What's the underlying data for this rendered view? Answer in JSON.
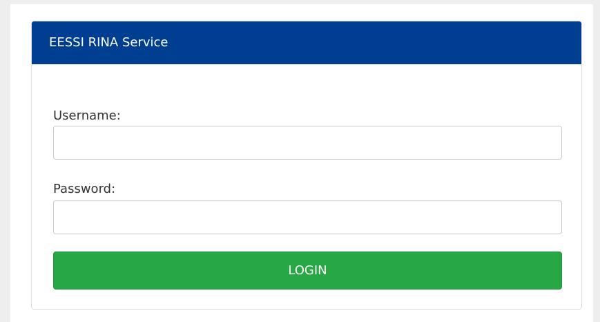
{
  "panel": {
    "title": "EESSI RINA Service"
  },
  "form": {
    "username_label": "Username:",
    "username_value": "",
    "password_label": "Password:",
    "password_value": "",
    "login_label": "LOGIN"
  },
  "colors": {
    "header_bg": "#003e92",
    "login_button_bg": "#28a745",
    "page_bg": "#eeeeee"
  }
}
